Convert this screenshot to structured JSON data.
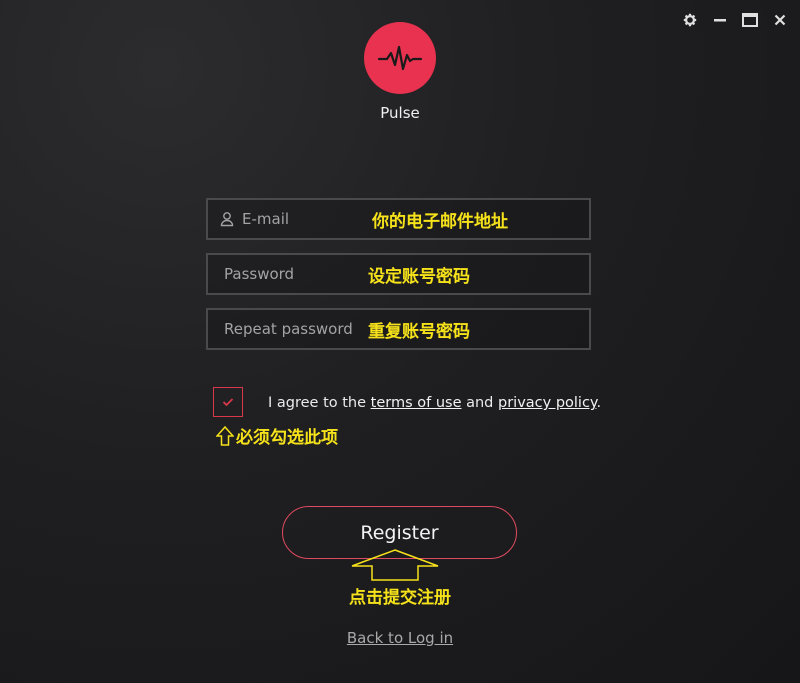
{
  "app": {
    "name": "Pulse"
  },
  "window_controls": [
    {
      "icon": "gear-icon"
    },
    {
      "icon": "minimize-icon"
    },
    {
      "icon": "maximize-icon"
    },
    {
      "icon": "close-icon"
    }
  ],
  "form": {
    "email": {
      "placeholder": "E-mail",
      "value": "",
      "annotation": "你的电子邮件地址"
    },
    "password": {
      "placeholder": "Password",
      "value": "",
      "annotation": "设定账号密码"
    },
    "repeat_password": {
      "placeholder": "Repeat password",
      "value": "",
      "annotation": "重复账号密码"
    },
    "agree": {
      "checked": true,
      "prefix": "I agree to the ",
      "terms_link": "terms of use",
      "middle": " and ",
      "privacy_link": "privacy policy",
      "suffix": ".",
      "annotation": "必须勾选此项"
    },
    "register_label": "Register",
    "register_annotation": "点击提交注册",
    "back_link": "Back to Log in"
  },
  "colors": {
    "accent": "#e8324f",
    "annotation": "#f6e21a",
    "background": "#1f1f21"
  }
}
